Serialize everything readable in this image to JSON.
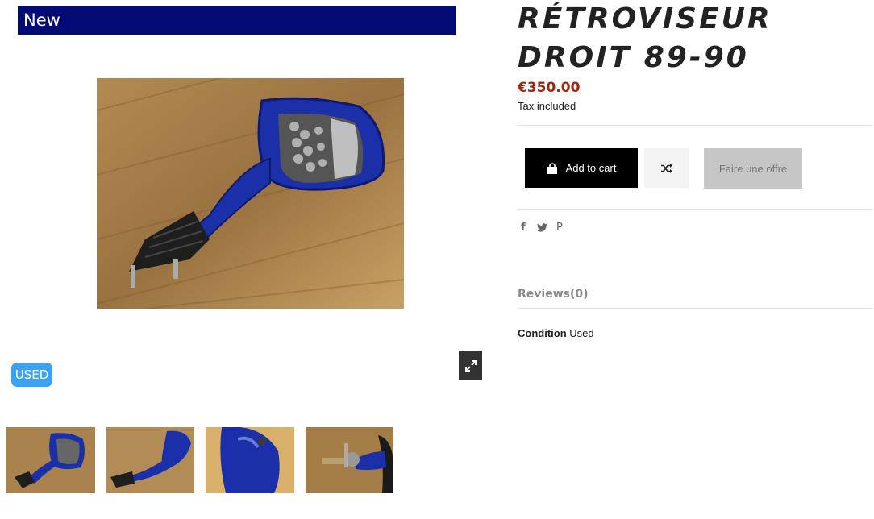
{
  "product": {
    "flag_label": "New",
    "condition_badge": "USED",
    "title": "RÉTROVISEUR DROIT 89-90",
    "price": "€350.00",
    "tax_note": "Tax included"
  },
  "actions": {
    "add_to_cart_label": "Add to cart",
    "offer_label": "Faire une offre",
    "compare_icon": "shuffle-icon",
    "cart_icon": "shopping-bag-icon",
    "zoom_icon": "expand-icon"
  },
  "social": {
    "icons": [
      "facebook-icon",
      "twitter-icon",
      "pinterest-icon"
    ],
    "facebook_glyph": "f",
    "pinterest_glyph": "P"
  },
  "tabs": {
    "reviews_label": "Reviews(0)"
  },
  "details": {
    "condition_label": "Condition",
    "condition_value": "Used"
  },
  "thumbnails_count": 4,
  "colors": {
    "banner_bg": "#020b74",
    "price": "#a0260e",
    "badge_bg": "#3da2f2",
    "mirror_blue": "#1b2fa8"
  }
}
